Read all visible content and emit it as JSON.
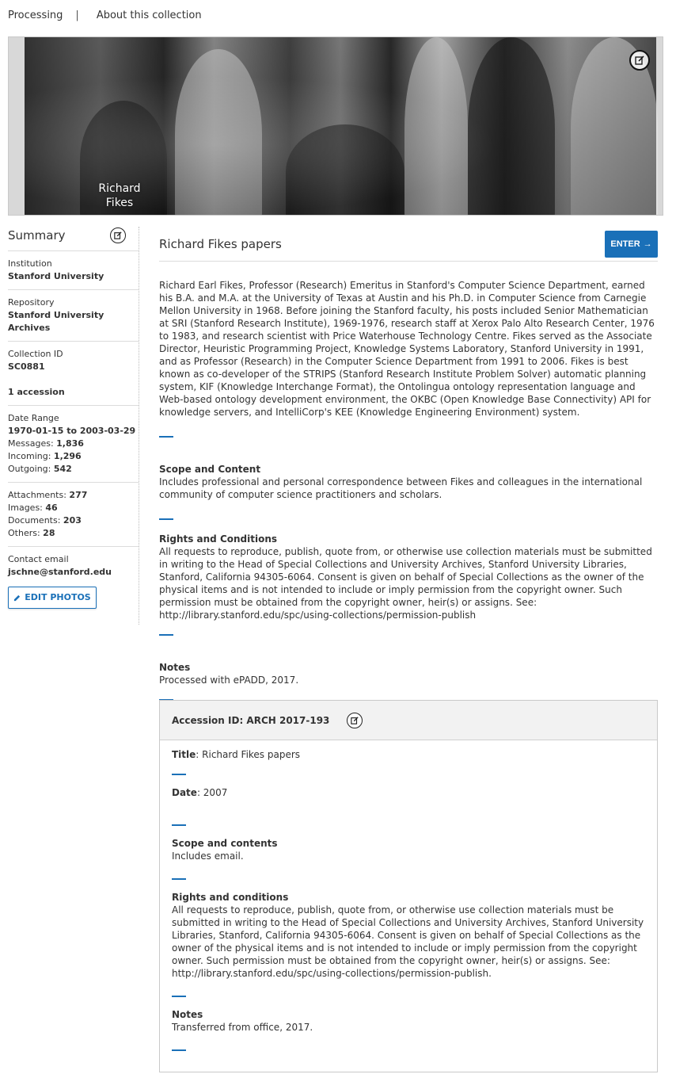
{
  "topnav": {
    "processing": "Processing",
    "separator": "|",
    "about": "About this collection"
  },
  "banner": {
    "caption": "Richard Fikes",
    "edit_icon": "edit-icon"
  },
  "summary": {
    "title": "Summary",
    "institution_label": "Institution",
    "institution": "Stanford University",
    "repository_label": "Repository",
    "repository": "Stanford University Archives",
    "collection_id_label": "Collection ID",
    "collection_id": "SC0881",
    "accessions": "1 accession",
    "date_range_label": "Date Range",
    "date_range": "1970-01-15 to 2003-03-29",
    "messages_label": "Messages: ",
    "messages": "1,836",
    "incoming_label": "Incoming: ",
    "incoming": "1,296",
    "outgoing_label": "Outgoing: ",
    "outgoing": "542",
    "attachments_label": "Attachments: ",
    "attachments": "277",
    "images_label": "Images: ",
    "images": "46",
    "documents_label": "Documents: ",
    "documents": "203",
    "others_label": "Others: ",
    "others": "28",
    "contact_label": "Contact email",
    "contact": "jschne@stanford.edu",
    "edit_photos": "EDIT PHOTOS"
  },
  "main": {
    "title": "Richard Fikes papers",
    "enter": "ENTER",
    "description": "Richard Earl Fikes, Professor (Research) Emeritus in Stanford's Computer Science Department, earned his B.A. and M.A. at the University of Texas at Austin and his Ph.D. in Computer Science from Carnegie Mellon University in 1968. Before joining the Stanford faculty, his posts included Senior Mathematician at SRI (Stanford Research Institute), 1969-1976, research staff at Xerox Palo Alto Research Center, 1976 to 1983, and research scientist with Price Waterhouse Technology Centre. Fikes served as the Associate Director, Heuristic Programming Project, Knowledge Systems Laboratory, Stanford University in 1991, and as Professor (Research) in the Computer Science Department from 1991 to 2006. Fikes is best known as co-developer of the STRIPS (Stanford Research Institute Problem Solver) automatic planning system, KIF (Knowledge Interchange Format), the Ontolingua ontology representation language and Web-based ontology development environment, the OKBC (Open Knowledge Base Connectivity) API for knowledge servers, and IntelliCorp's KEE (Knowledge Engineering Environment) system.",
    "scope_title": "Scope and Content",
    "scope": "Includes professional and personal correspondence between Fikes and colleagues in the international community of computer science practitioners and scholars.",
    "rights_title": "Rights and Conditions",
    "rights": "All requests to reproduce, publish, quote from, or otherwise use collection materials must be submitted in writing to the Head of Special Collections and University Archives, Stanford University Libraries, Stanford, California 94305-6064. Consent is given on behalf of Special Collections as the owner of the physical items and is not intended to include or imply permission from the copyright owner. Such permission must be obtained from the copyright owner, heir(s) or assigns. See: http://library.stanford.edu/spc/using-collections/permission-publish",
    "notes_title": "Notes",
    "notes": "Processed with ePADD, 2017."
  },
  "accession": {
    "header": "Accession ID: ARCH 2017-193",
    "title_label": "Title",
    "title": ": Richard Fikes papers",
    "date_label": "Date",
    "date": ": 2007",
    "scope_title": "Scope and contents",
    "scope": "Includes email.",
    "rights_title": "Rights and conditions",
    "rights": "All requests to reproduce, publish, quote from, or otherwise use collection materials must be submitted in writing to the Head of Special Collections and University Archives, Stanford University Libraries, Stanford, California 94305-6064. Consent is given on behalf of Special Collections as the owner of the physical items and is not intended to include or imply permission from the copyright owner. Such permission must be obtained from the copyright owner, heir(s) or assigns. See: http://library.stanford.edu/spc/using-collections/permission-publish.",
    "notes_title": "Notes",
    "notes": "Transferred from office, 2017."
  },
  "colors": {
    "accent": "#1a70b8",
    "text": "#333333",
    "divider": "#dcdcdc"
  }
}
